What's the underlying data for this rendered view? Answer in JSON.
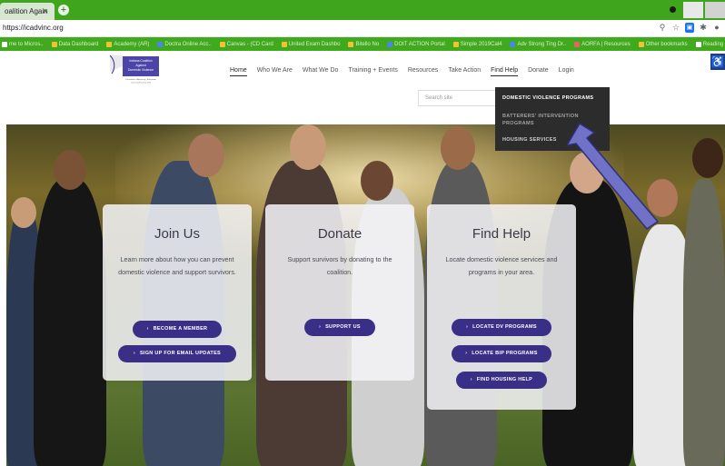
{
  "browser": {
    "tab_title": "oalition Again",
    "tab_close": "×",
    "new_tab": "+",
    "url": "https://icadvinc.org",
    "bookmarks": [
      {
        "label": "me to Micros..",
        "icon": "w"
      },
      {
        "label": "Data Dashboard",
        "icon": "y"
      },
      {
        "label": "Academy (AR)",
        "icon": "y"
      },
      {
        "label": "Doctra Online Acc..",
        "icon": "b"
      },
      {
        "label": "Canvas - (CD Card",
        "icon": "y"
      },
      {
        "label": "United Exam Dashbo",
        "icon": "y"
      },
      {
        "label": "Bitello No",
        "icon": "y"
      },
      {
        "label": "DOIT ACTION Portal",
        "icon": "b"
      },
      {
        "label": "Simple 2019Cal4",
        "icon": "y"
      },
      {
        "label": "Adv Strong Ting Dr..",
        "icon": "b"
      },
      {
        "label": "AORFA | Resources",
        "icon": "r"
      },
      {
        "label": "Other bookmarks",
        "icon": "y"
      },
      {
        "label": "Reading",
        "icon": "w"
      }
    ]
  },
  "site": {
    "logo_lines": [
      "Indiana Coalition",
      "Against",
      "Domestic Violence",
      "Prevention • Advocacy • Education",
      "Chell Org Founded 1980"
    ],
    "nav": [
      "Home",
      "Who We Are",
      "What We Do",
      "Training + Events",
      "Resources",
      "Take Action",
      "Find Help",
      "Donate",
      "Login"
    ],
    "search_placeholder": "Search site",
    "dropdown": {
      "item1": "Domestic Violence Programs",
      "item2_line1": "Batterers' Intervention",
      "item2_line2": "Programs",
      "item3": "Housing Services"
    }
  },
  "cards": {
    "join": {
      "title": "Join Us",
      "text": "Learn more about how you can prevent domestic violence and support survivors.",
      "btn1": "BECOME A MEMBER",
      "btn2": "SIGN UP FOR EMAIL UPDATES"
    },
    "donate": {
      "title": "Donate",
      "text": "Support survivors by donating to the coalition.",
      "btn1": "SUPPORT US"
    },
    "help": {
      "title": "Find Help",
      "text": "Locate domestic violence services and programs in your area.",
      "btn1": "LOCATE DV PROGRAMS",
      "btn2": "LOCATE BIP PROGRAMS",
      "btn3": "FIND HOUSING HELP"
    }
  },
  "colors": {
    "browser_green": "#3fa51c",
    "button_purple": "#3a2f86",
    "dropdown_bg": "#2c2c2c",
    "arrow_blue": "#7072c8"
  },
  "icons": {
    "accessibility": "wheelchair-icon",
    "button_arrow": "chevron-right-icon"
  }
}
